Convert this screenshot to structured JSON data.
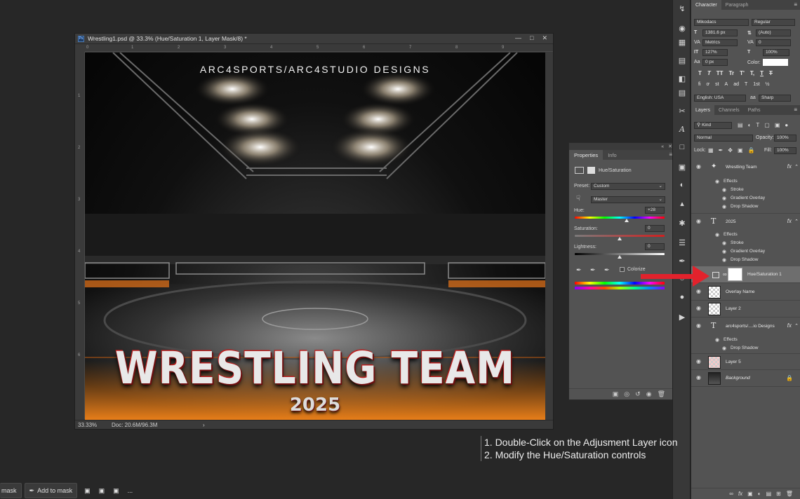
{
  "document": {
    "title": "Wrestling1.psd @ 33.3% (Hue/Saturation 1, Layer Mask/8) *",
    "zoom": "33.33%",
    "doc_size": "Doc: 20.6M/96.3M",
    "ruler_h": [
      "0",
      "1",
      "2",
      "3",
      "4",
      "5",
      "6",
      "7",
      "8",
      "9"
    ],
    "ruler_v": [
      "1",
      "2",
      "3",
      "4",
      "5",
      "6"
    ],
    "artwork": {
      "brand": "ARC4SPORTS/ARC4STUDIO DESIGNS",
      "headline": "WRESTLING TEAM",
      "year": "2025"
    }
  },
  "properties": {
    "tabs": [
      "Properties",
      "Info"
    ],
    "adjustment_name": "Hue/Saturation",
    "preset_label": "Preset:",
    "preset_value": "Custom",
    "channel_value": "Master",
    "hue_label": "Hue:",
    "hue_value": "+28",
    "hue_level": 0.58,
    "saturation_label": "Saturation:",
    "saturation_value": "0",
    "lightness_label": "Lightness:",
    "lightness_value": "0",
    "colorize_label": "Colorize"
  },
  "character": {
    "tabs": [
      "Character",
      "Paragraph"
    ],
    "font_family": "Mikodacs",
    "font_style": "Regular",
    "font_size": "1381.6 px",
    "leading": "(Auto)",
    "kerning": "Metrics",
    "tracking": "0",
    "vertical_scale": "127%",
    "horizontal_scale": "100%",
    "baseline_shift": "0 px",
    "color_label": "Color:",
    "language": "English: USA",
    "anti_alias_prefix": "aa",
    "anti_alias": "Sharp",
    "style_buttons": [
      "T",
      "T",
      "TT",
      "Tr",
      "T'",
      "T,",
      "T",
      "T"
    ],
    "opentype_buttons": [
      "fi",
      "ơ",
      "st",
      "A",
      "ad",
      "T",
      "1st",
      "½"
    ]
  },
  "layers_panel": {
    "tabs": [
      "Layers",
      "Channels",
      "Paths"
    ],
    "filter": "Kind",
    "blend_mode": "Normal",
    "opacity_label": "Opacity:",
    "opacity": "100%",
    "lock_label": "Lock:",
    "fill_label": "Fill:",
    "fill": "100%",
    "effects_label": "Effects",
    "layers": [
      {
        "name": "Wrestling Team",
        "fx": "fx",
        "effects": [
          "Stroke",
          "Gradient Overlay",
          "Drop Shadow"
        ]
      },
      {
        "name": "2025",
        "fx": "fx",
        "effects": [
          "Stroke",
          "Gradient Overlay",
          "Drop Shadow"
        ]
      },
      {
        "name": "Hue/Saturation 1"
      },
      {
        "name": "Overlay Name"
      },
      {
        "name": "Layer 2"
      },
      {
        "name": "arc4sports/....io Designs",
        "fx": "fx",
        "effects": [
          "Drop Shadow"
        ]
      },
      {
        "name": "Layer 5"
      },
      {
        "name": "Background"
      }
    ]
  },
  "instructions": [
    "1. Double-Click on the Adjusment Layer icon",
    "2. Modify the Hue/Saturation controls"
  ],
  "bottom_bar": {
    "mask_partial": "mask",
    "add_to_mask": "Add to mask",
    "more": "..."
  },
  "colors": {
    "accent_arrow": "#e2222c",
    "panel_bg": "#535353",
    "app_bg": "#272727"
  }
}
